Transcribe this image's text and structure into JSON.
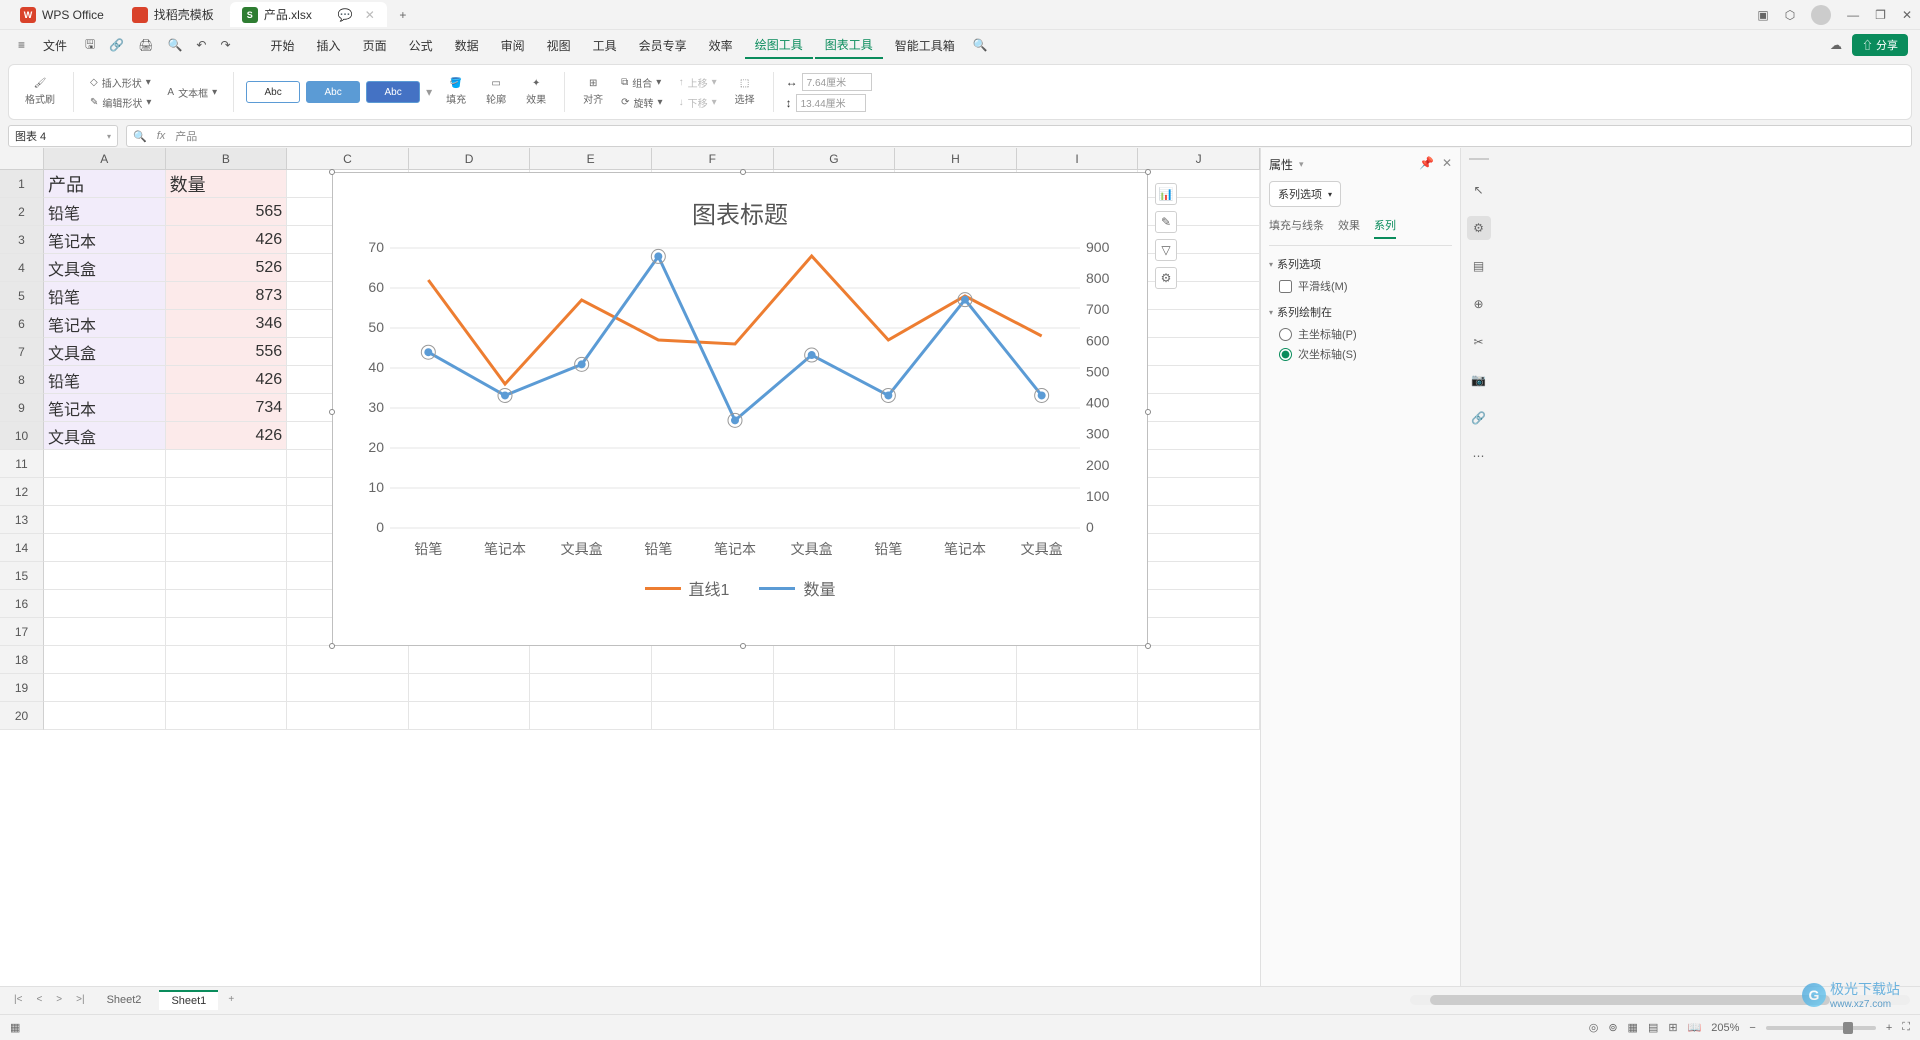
{
  "titlebar": {
    "tabs": [
      {
        "label": "WPS Office",
        "type": "wps"
      },
      {
        "label": "找稻壳模板",
        "type": "tmpl"
      },
      {
        "label": "产品.xlsx",
        "type": "xls",
        "active": true
      }
    ],
    "add": "+",
    "window_controls": [
      "▢",
      "⬡",
      "👤",
      "—",
      "❐",
      "✕"
    ]
  },
  "menubar": {
    "file": "文件",
    "items": [
      "开始",
      "插入",
      "页面",
      "公式",
      "数据",
      "审阅",
      "视图",
      "工具",
      "会员专享",
      "效率",
      "绘图工具",
      "图表工具",
      "智能工具箱"
    ],
    "active": [
      "绘图工具",
      "图表工具"
    ],
    "share": "分享"
  },
  "ribbon": {
    "format_brush": "格式刷",
    "insert_shape": "插入形状",
    "text_box": "文本框",
    "edit_shape": "编辑形状",
    "abc": "Abc",
    "fill": "填充",
    "outline": "轮廓",
    "effect": "效果",
    "align": "对齐",
    "group": "组合",
    "rotate": "旋转",
    "up": "上移",
    "down": "下移",
    "select": "选择",
    "w": "7.64厘米",
    "h": "13.44厘米"
  },
  "formula": {
    "name": "图表 4",
    "fx": "fx",
    "value": "产品"
  },
  "sheet": {
    "cols": [
      "A",
      "B",
      "C",
      "D",
      "E",
      "F",
      "G",
      "H",
      "I",
      "J"
    ],
    "rows": 20,
    "header": {
      "A": "产品",
      "B": "数量"
    },
    "data": [
      {
        "A": "铅笔",
        "B": "565"
      },
      {
        "A": "笔记本",
        "B": "426"
      },
      {
        "A": "文具盒",
        "B": "526"
      },
      {
        "A": "铅笔",
        "B": "873"
      },
      {
        "A": "笔记本",
        "B": "346"
      },
      {
        "A": "文具盒",
        "B": "556"
      },
      {
        "A": "铅笔",
        "B": "426"
      },
      {
        "A": "笔记本",
        "B": "734"
      },
      {
        "A": "文具盒",
        "B": "426"
      }
    ]
  },
  "chart_data": {
    "type": "line",
    "title": "图表标题",
    "categories": [
      "铅笔",
      "笔记本",
      "文具盒",
      "铅笔",
      "笔记本",
      "文具盒",
      "铅笔",
      "笔记本",
      "文具盒"
    ],
    "series": [
      {
        "name": "直线1",
        "axis": "primary",
        "color": "#ed7d31",
        "values": [
          62,
          36,
          57,
          47,
          46,
          68,
          47,
          58,
          48
        ]
      },
      {
        "name": "数量",
        "axis": "secondary",
        "color": "#5b9bd5",
        "values": [
          565,
          426,
          526,
          873,
          346,
          556,
          426,
          734,
          426
        ]
      }
    ],
    "y_primary": {
      "min": 0,
      "max": 70,
      "ticks": [
        0,
        10,
        20,
        30,
        40,
        50,
        60,
        70
      ]
    },
    "y_secondary": {
      "min": 0,
      "max": 900,
      "ticks": [
        0,
        100,
        200,
        300,
        400,
        500,
        600,
        700,
        800,
        900
      ]
    },
    "legend_pos": "bottom"
  },
  "chart_sidebtns": [
    "chart-type",
    "edit",
    "filter",
    "settings"
  ],
  "rightpanel": {
    "header": "属性",
    "dropdown": "系列选项",
    "tabs": [
      "填充与线条",
      "效果",
      "系列"
    ],
    "active_tab": "系列",
    "section1": "系列选项",
    "smooth_label": "平滑线(M)",
    "section2": "系列绘制在",
    "radio1": "主坐标轴(P)",
    "radio2": "次坐标轴(S)"
  },
  "sheettabs": {
    "tabs": [
      "Sheet2",
      "Sheet1"
    ],
    "active": "Sheet1",
    "add": "+"
  },
  "statusbar": {
    "zoom": "205%"
  },
  "watermark": {
    "text": "极光下载站",
    "url": "www.xz7.com"
  }
}
